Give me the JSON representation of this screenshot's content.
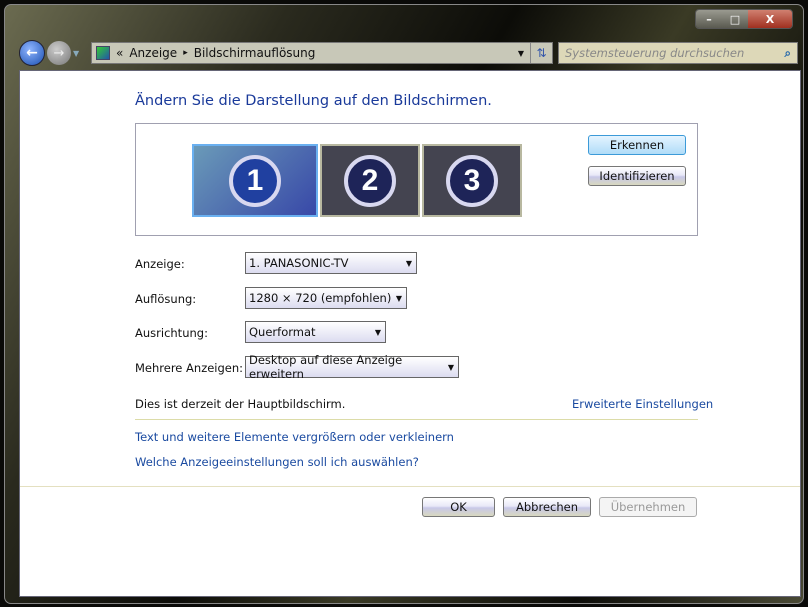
{
  "window": {
    "min": "–",
    "max": "□",
    "close": "X"
  },
  "address": {
    "chevron": "«",
    "crumbs": [
      "Anzeige",
      "Bildschirmauflösung"
    ],
    "separator": "▸"
  },
  "search": {
    "placeholder": "Systemsteuerung durchsuchen"
  },
  "main": {
    "title": "Ändern Sie die Darstellung auf den Bildschirmen.",
    "monitors": [
      {
        "number": "1",
        "selected": true
      },
      {
        "number": "2",
        "selected": false
      },
      {
        "number": "3",
        "selected": false
      }
    ],
    "detect_label": "Erkennen",
    "identify_label": "Identifizieren",
    "fields": [
      {
        "label": "Anzeige:",
        "value": "1. PANASONIC-TV"
      },
      {
        "label": "Auflösung:",
        "value": "1280 × 720 (empfohlen)"
      },
      {
        "label": "Ausrichtung:",
        "value": "Querformat"
      },
      {
        "label": "Mehrere Anzeigen:",
        "value": "Desktop auf diese Anzeige erweitern"
      }
    ],
    "main_display_text": "Dies ist derzeit der Hauptbildschirm.",
    "advanced_link": "Erweiterte Einstellungen",
    "link_resize": "Text und weitere Elemente vergrößern oder verkleinern",
    "link_help": "Welche Anzeigeeinstellungen soll ich auswählen?"
  },
  "footer": {
    "ok": "OK",
    "cancel": "Abbrechen",
    "apply": "Übernehmen"
  }
}
